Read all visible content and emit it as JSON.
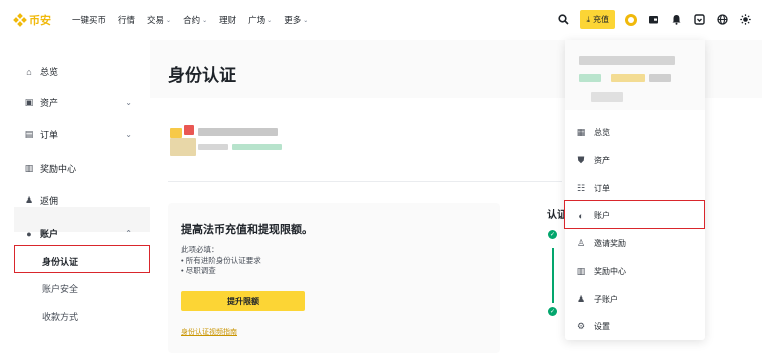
{
  "colors": {
    "brand": "#f0b90b",
    "accent": "#fcd535",
    "highlight": "#d9262c",
    "success": "#03a66d"
  },
  "topbar": {
    "logo_text": "币安",
    "nav": [
      {
        "label": "一键买币",
        "has_menu": false
      },
      {
        "label": "行情",
        "has_menu": false
      },
      {
        "label": "交易",
        "has_menu": true
      },
      {
        "label": "合约",
        "has_menu": true
      },
      {
        "label": "理财",
        "has_menu": false
      },
      {
        "label": "广场",
        "has_menu": true
      },
      {
        "label": "更多",
        "has_menu": true
      }
    ],
    "deposit_label": "充值",
    "icons": [
      "search-icon",
      "deposit-icon",
      "user-icon",
      "wallet-icon",
      "bell-icon",
      "download-icon",
      "globe-icon",
      "theme-icon"
    ]
  },
  "sidebar": {
    "items": [
      {
        "label": "总览",
        "icon": "home-icon"
      },
      {
        "label": "资产",
        "icon": "wallet-icon",
        "expandable": true
      },
      {
        "label": "订单",
        "icon": "order-icon",
        "expandable": true
      },
      {
        "label": "奖励中心",
        "icon": "rewards-icon"
      },
      {
        "label": "返佣",
        "icon": "referral-icon"
      },
      {
        "label": "账户",
        "icon": "person-icon",
        "expanded": true
      }
    ],
    "sub_items": [
      {
        "label": "身份认证",
        "active": true
      },
      {
        "label": "账户安全",
        "active": false
      },
      {
        "label": "收款方式",
        "active": false
      }
    ]
  },
  "main": {
    "page_title": "身份认证",
    "card": {
      "title": "提高法币充值和提现限额。",
      "required_label": "此项必填：",
      "requirements": [
        "• 所有进阶身份认证要求",
        "• 尽职调查"
      ],
      "button_label": "提升限额",
      "guide_link": "身份认证视频指南"
    },
    "verify_label": "认证"
  },
  "dropdown": {
    "items": [
      {
        "label": "总览",
        "icon": "dashboard-icon"
      },
      {
        "label": "资产",
        "icon": "shield-icon"
      },
      {
        "label": "订单",
        "icon": "list-icon"
      },
      {
        "label": "账户",
        "icon": "account-icon",
        "highlighted": true
      },
      {
        "label": "邀请奖励",
        "icon": "invite-icon"
      },
      {
        "label": "奖励中心",
        "icon": "rewards-icon"
      },
      {
        "label": "子账户",
        "icon": "subaccount-icon"
      },
      {
        "label": "设置",
        "icon": "settings-icon"
      }
    ]
  }
}
